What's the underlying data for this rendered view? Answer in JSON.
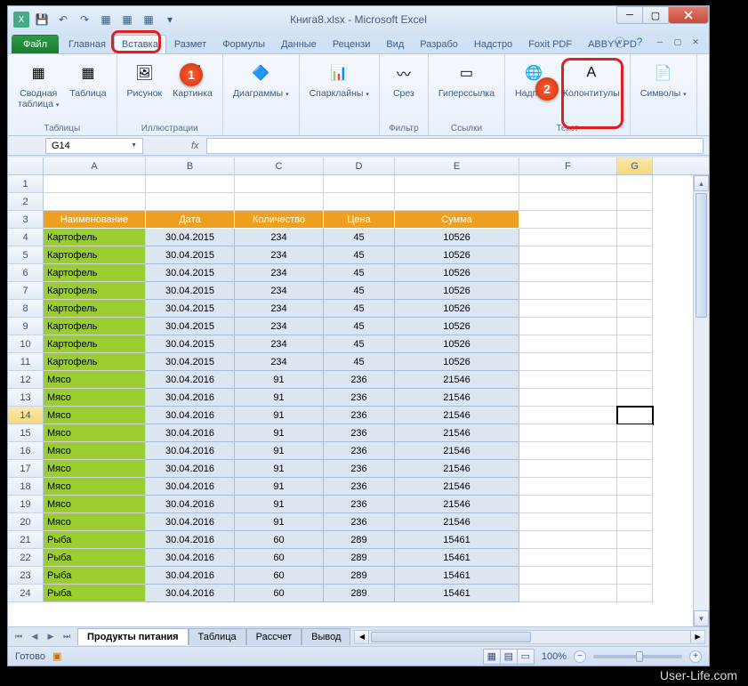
{
  "title": "Книга8.xlsx - Microsoft Excel",
  "qat": {
    "save": "💾",
    "undo": "↶",
    "redo": "↷"
  },
  "tabs": {
    "file": "Файл",
    "items": [
      "Главная",
      "Вставка",
      "Размет",
      "Формулы",
      "Данные",
      "Рецензи",
      "Вид",
      "Разрабо",
      "Надстро",
      "Foxit PDF",
      "ABBYY PD"
    ],
    "active_index": 1
  },
  "ribbon": {
    "groups": [
      {
        "label": "Таблицы",
        "buttons": [
          {
            "l": "Сводная\nтаблица",
            "dd": true
          },
          {
            "l": "Таблица"
          }
        ]
      },
      {
        "label": "Иллюстрации",
        "buttons": [
          {
            "l": "Рисунок"
          },
          {
            "l": "Картинка"
          }
        ]
      },
      {
        "label": "",
        "buttons": [
          {
            "l": "Диаграммы",
            "dd": true
          }
        ]
      },
      {
        "label": "",
        "buttons": [
          {
            "l": "Спарклайны",
            "dd": true
          }
        ]
      },
      {
        "label": "Фильтр",
        "buttons": [
          {
            "l": "Срез"
          }
        ]
      },
      {
        "label": "Ссылки",
        "buttons": [
          {
            "l": "Гиперссылка"
          }
        ]
      },
      {
        "label": "Текст",
        "buttons": [
          {
            "l": "Надпись"
          },
          {
            "l": "Колонтитулы"
          }
        ]
      },
      {
        "label": "",
        "buttons": [
          {
            "l": "Символы",
            "dd": true
          }
        ]
      }
    ]
  },
  "namebox": "G14",
  "fx": "fx",
  "columns": [
    "A",
    "B",
    "C",
    "D",
    "E",
    "F",
    "G"
  ],
  "header_row": 3,
  "headers": [
    "Наименование",
    "Дата",
    "Количество",
    "Цена",
    "Сумма"
  ],
  "selected_row": 14,
  "selected_col": "G",
  "rows": [
    {
      "n": 1,
      "d": []
    },
    {
      "n": 2,
      "d": []
    },
    {
      "n": 4,
      "d": [
        "Картофель",
        "30.04.2015",
        "234",
        "45",
        "10526"
      ]
    },
    {
      "n": 5,
      "d": [
        "Картофель",
        "30.04.2015",
        "234",
        "45",
        "10526"
      ]
    },
    {
      "n": 6,
      "d": [
        "Картофель",
        "30.04.2015",
        "234",
        "45",
        "10526"
      ]
    },
    {
      "n": 7,
      "d": [
        "Картофель",
        "30.04.2015",
        "234",
        "45",
        "10526"
      ]
    },
    {
      "n": 8,
      "d": [
        "Картофель",
        "30.04.2015",
        "234",
        "45",
        "10526"
      ]
    },
    {
      "n": 9,
      "d": [
        "Картофель",
        "30.04.2015",
        "234",
        "45",
        "10526"
      ]
    },
    {
      "n": 10,
      "d": [
        "Картофель",
        "30.04.2015",
        "234",
        "45",
        "10526"
      ]
    },
    {
      "n": 11,
      "d": [
        "Картофель",
        "30.04.2015",
        "234",
        "45",
        "10526"
      ]
    },
    {
      "n": 12,
      "d": [
        "Мясо",
        "30.04.2016",
        "91",
        "236",
        "21546"
      ]
    },
    {
      "n": 13,
      "d": [
        "Мясо",
        "30.04.2016",
        "91",
        "236",
        "21546"
      ]
    },
    {
      "n": 14,
      "d": [
        "Мясо",
        "30.04.2016",
        "91",
        "236",
        "21546"
      ]
    },
    {
      "n": 15,
      "d": [
        "Мясо",
        "30.04.2016",
        "91",
        "236",
        "21546"
      ]
    },
    {
      "n": 16,
      "d": [
        "Мясо",
        "30.04.2016",
        "91",
        "236",
        "21546"
      ]
    },
    {
      "n": 17,
      "d": [
        "Мясо",
        "30.04.2016",
        "91",
        "236",
        "21546"
      ]
    },
    {
      "n": 18,
      "d": [
        "Мясо",
        "30.04.2016",
        "91",
        "236",
        "21546"
      ]
    },
    {
      "n": 19,
      "d": [
        "Мясо",
        "30.04.2016",
        "91",
        "236",
        "21546"
      ]
    },
    {
      "n": 20,
      "d": [
        "Мясо",
        "30.04.2016",
        "91",
        "236",
        "21546"
      ]
    },
    {
      "n": 21,
      "d": [
        "Рыба",
        "30.04.2016",
        "60",
        "289",
        "15461"
      ]
    },
    {
      "n": 22,
      "d": [
        "Рыба",
        "30.04.2016",
        "60",
        "289",
        "15461"
      ]
    },
    {
      "n": 23,
      "d": [
        "Рыба",
        "30.04.2016",
        "60",
        "289",
        "15461"
      ]
    },
    {
      "n": 24,
      "d": [
        "Рыба",
        "30.04.2016",
        "60",
        "289",
        "15461"
      ]
    }
  ],
  "sheets": {
    "active": "Продукты питания",
    "others": [
      "Таблица",
      "Рассчет",
      "Вывод"
    ]
  },
  "status": {
    "ready": "Готово",
    "zoom": "100%"
  },
  "badges": {
    "one": "1",
    "two": "2"
  },
  "watermark": "User-Life.com"
}
